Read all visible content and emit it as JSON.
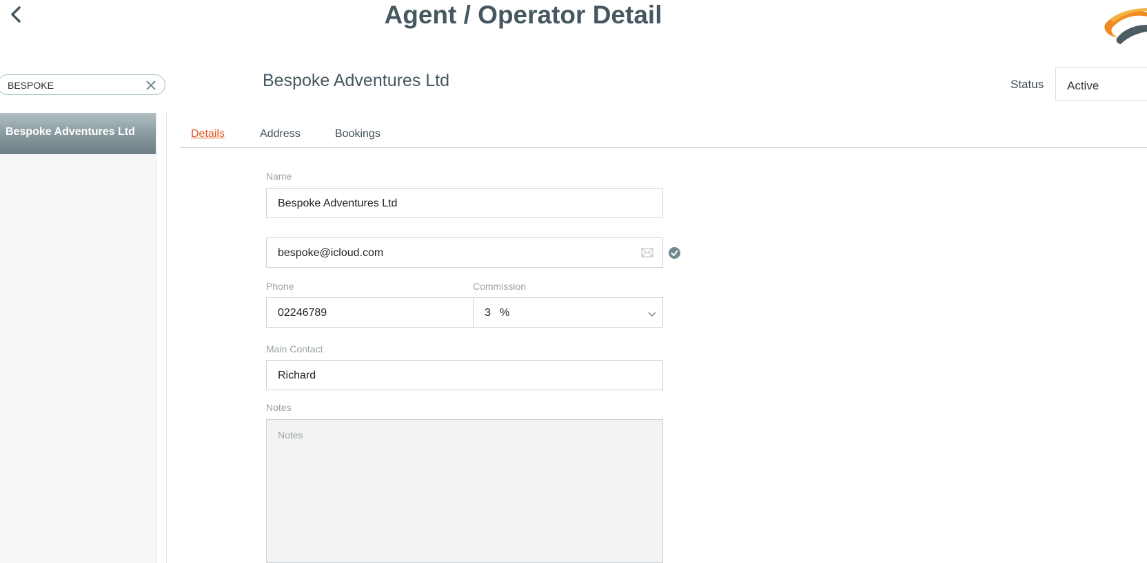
{
  "header": {
    "title": "Agent / Operator Detail"
  },
  "search": {
    "value": "BESPOKE"
  },
  "sidebar": {
    "items": [
      {
        "label": "Bespoke Adventures Ltd",
        "active": true
      }
    ]
  },
  "record": {
    "title": "Bespoke Adventures Ltd",
    "status_label": "Status",
    "status_value": "Active"
  },
  "tabs": [
    {
      "label": "Details",
      "active": true
    },
    {
      "label": "Address",
      "active": false
    },
    {
      "label": "Bookings",
      "active": false
    }
  ],
  "form": {
    "name_label": "Name",
    "name_value": "Bespoke Adventures Ltd",
    "email_value": "bespoke@icloud.com",
    "phone_label": "Phone",
    "phone_value": "02246789",
    "commission_label": "Commission",
    "commission_value": "3",
    "commission_unit": "%",
    "contact_label": "Main Contact",
    "contact_value": "Richard",
    "notes_label": "Notes",
    "notes_placeholder": "Notes"
  },
  "colors": {
    "accent": "#e2571e",
    "title": "#46575f",
    "verified": "#6f8a90"
  },
  "icons": {
    "back": "chevron-left-icon",
    "clear": "close-icon",
    "mail": "envelope-icon",
    "verified": "check-circle-icon",
    "dropdown": "chevron-down-icon",
    "logo": "swoosh-logo"
  }
}
